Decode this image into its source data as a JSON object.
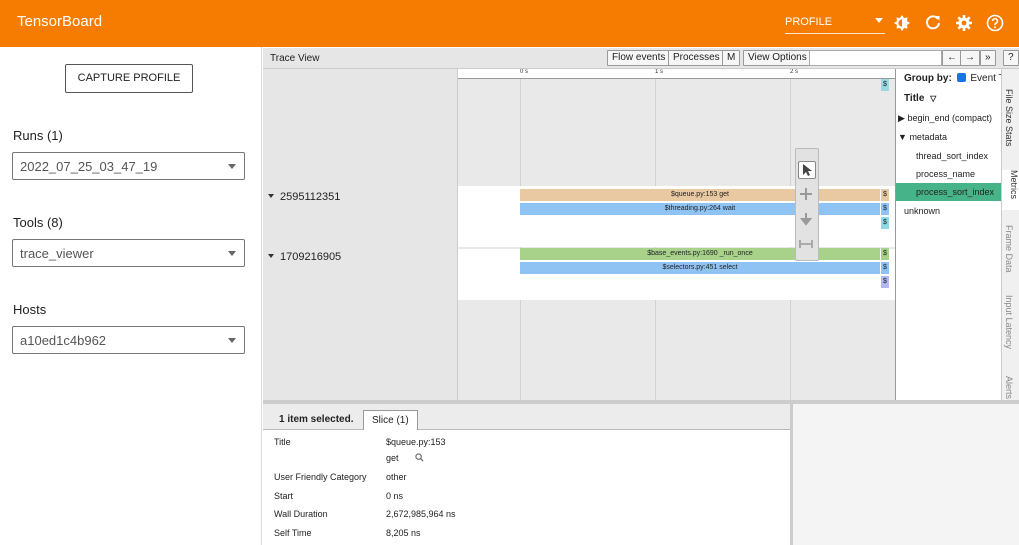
{
  "app": {
    "title": "TensorBoard",
    "plugin": "PROFILE",
    "colors": {
      "topbar": "#f57c00",
      "selected": "#46b488"
    }
  },
  "sidebar": {
    "capture_label": "CAPTURE PROFILE",
    "runs_label": "Runs (1)",
    "runs_value": "2022_07_25_03_47_19",
    "tools_label": "Tools (8)",
    "tools_value": "trace_viewer",
    "hosts_label": "Hosts",
    "hosts_value": "a10ed1c4b962"
  },
  "trace": {
    "title": "Trace View",
    "buttons": [
      "Flow events",
      "Processes",
      "M",
      "View Options"
    ],
    "nav": [
      "←",
      "→",
      "»",
      "?"
    ],
    "ruler": [
      "0 s",
      "1 s",
      "2 s"
    ],
    "tracks": [
      {
        "id": "2595112351",
        "slices": [
          "$queue.py:153 get",
          "$threading.py:264 wait"
        ]
      },
      {
        "id": "1709216905",
        "slices": [
          "$base_events.py:1690 _run_once",
          "$selectors.py:451 select"
        ]
      }
    ],
    "side_panel": {
      "group_by": "Group by:",
      "group_by_option": "Event Ty",
      "title": "Title",
      "items": [
        "begin_end (compact)",
        "metadata",
        "thread_sort_index",
        "process_name",
        "process_sort_index",
        "unknown"
      ],
      "truncated_marker": "$"
    },
    "side_tabs": [
      "File Size Stats",
      "Metrics",
      "Frame Data",
      "Input Latency",
      "Alerts"
    ]
  },
  "details": {
    "selected_label": "1 item selected.",
    "tab": "Slice (1)",
    "rows": [
      {
        "k": "Title",
        "v": "$queue.py:153"
      },
      {
        "k": "",
        "v": "get"
      },
      {
        "k": "User Friendly Category",
        "v": "other"
      },
      {
        "k": "Start",
        "v": "0 ns"
      },
      {
        "k": "Wall Duration",
        "v": "2,672,985,964 ns"
      },
      {
        "k": "Self Time",
        "v": "8,205 ns"
      }
    ]
  }
}
